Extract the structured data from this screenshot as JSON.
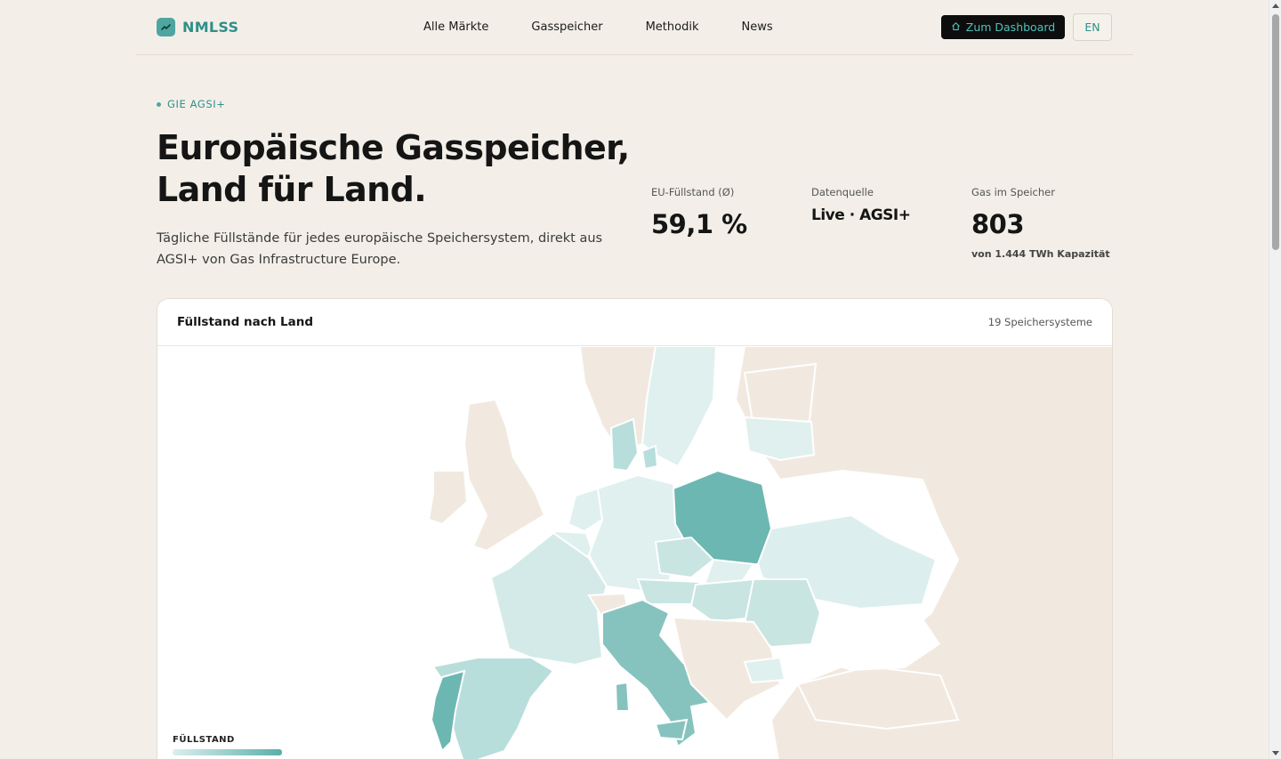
{
  "brand": {
    "name": "NMLSS"
  },
  "nav": {
    "items": [
      "Alle Märkte",
      "Gasspeicher",
      "Methodik",
      "News"
    ]
  },
  "actions": {
    "dashboard_label": "Zum Dashboard",
    "language_label": "EN"
  },
  "hero": {
    "kicker": "GIE AGSI+",
    "title_line1": "Europäische Gasspeicher,",
    "title_line2": "Land für Land.",
    "lede": "Tägliche Füllstände für jedes europäische Speichersystem, direkt aus AGSI+ von Gas Infrastructure Europe."
  },
  "stats": [
    {
      "label": "EU-Füllstand (Ø)",
      "value": "59,1 %"
    },
    {
      "label": "Datenquelle",
      "value": "Live · AGSI+"
    },
    {
      "label": "Gas im Speicher",
      "value": "803",
      "sub": "von 1.444 TWh Kapazität"
    }
  ],
  "map_card": {
    "title": "Füllstand nach Land",
    "count": "19 Speichersysteme",
    "legend_title": "FÜLLSTAND"
  },
  "colors": {
    "accent": "#2f8f8a",
    "fill_low": "#dcefee",
    "fill_high": "#5aafa9",
    "no_data": "#f1e9df"
  }
}
